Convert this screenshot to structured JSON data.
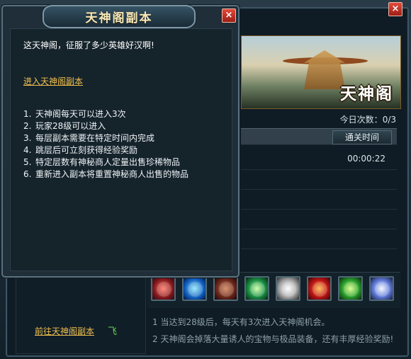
{
  "background": {
    "close_label": "×",
    "banner": {
      "title": "天神阁"
    },
    "today_count": {
      "label": "今日次数：",
      "value": "0/3"
    },
    "table": {
      "columns": [
        "通关时间"
      ],
      "rows": [
        {
          "time": "00:00:22"
        }
      ]
    },
    "reward_icons": [
      "red-gem-icon",
      "blue-gem-icon",
      "treasure-chest-icon",
      "green-orb-icon",
      "white-pet-icon",
      "red-rune-icon",
      "green-crystal-icon",
      "blue-sphere-icon"
    ],
    "info_lines": [
      "1  当达到28级后，每天有3次进入天神阁机会。",
      "2  天神阁会掉落大量诱人的宝物与极品装备，还有丰厚经验奖励!"
    ],
    "goto_link": "前往天神阁副本",
    "goto_glyph": "飞"
  },
  "dialog": {
    "title": "天神阁副本",
    "close_label": "×",
    "headline": "这天神阁，征服了多少英雄好汉啊!",
    "enter_link": "进入天神阁副本",
    "rules": [
      {
        "num": "1.",
        "text": "天神阁每天可以进入3次"
      },
      {
        "num": "2.",
        "text": "玩家28级可以进入"
      },
      {
        "num": "3.",
        "text": "每层副本需要在特定时间内完成"
      },
      {
        "num": "4.",
        "text": "跳层后可立刻获得经验奖励"
      },
      {
        "num": "5.",
        "text": "特定层数有神秘商人定量出售珍稀物品"
      },
      {
        "num": "6.",
        "text": "重新进入副本将重置神秘商人出售的物品"
      }
    ]
  }
}
